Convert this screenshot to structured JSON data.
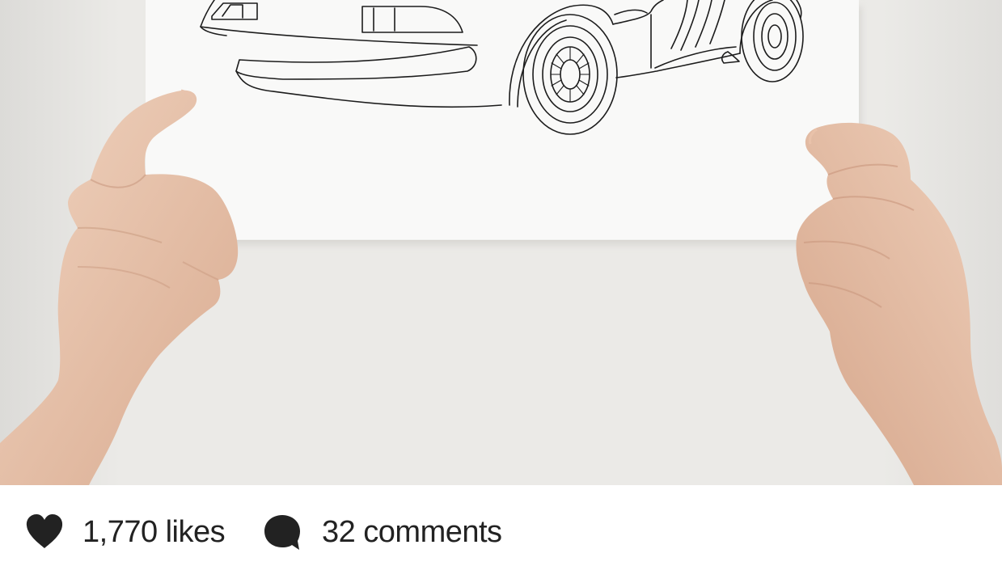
{
  "post": {
    "image_alt": "Hands holding a line drawing of a car"
  },
  "stats": {
    "likes_count": "1,770",
    "likes_unit": "likes",
    "comments_count": "32",
    "comments_unit": "comments",
    "likes_icon": "heart-icon",
    "comments_icon": "comment-bubble-icon",
    "icon_color": "#222222",
    "text_color": "#222222"
  }
}
